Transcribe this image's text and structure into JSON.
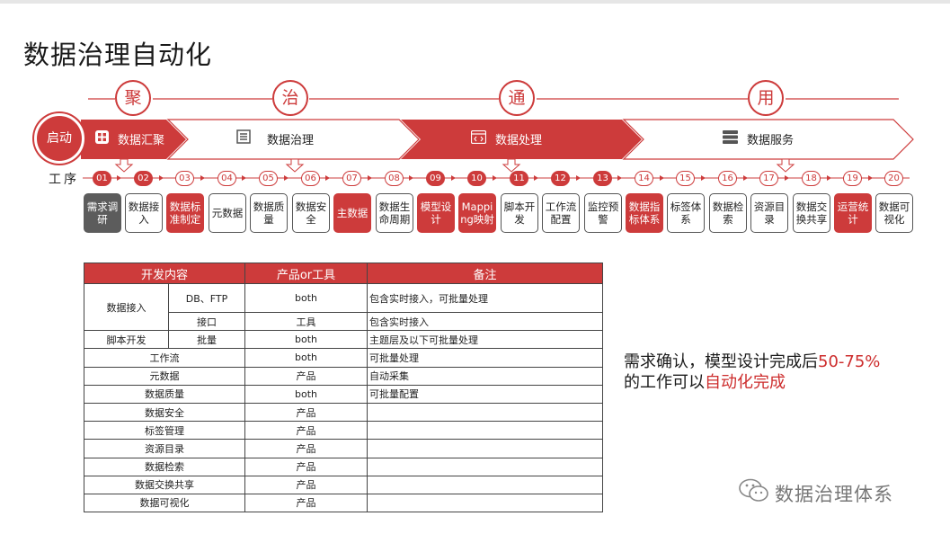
{
  "title": "数据治理自动化",
  "phase_chars": [
    "聚",
    "治",
    "通",
    "用"
  ],
  "start_label": "启动",
  "stages": [
    "数据汇聚",
    "数据治理",
    "数据处理",
    "数据服务"
  ],
  "gongxu_label": "工序",
  "steps": [
    {
      "num": "01",
      "label": "需求调研",
      "style": "gray"
    },
    {
      "num": "02",
      "label": "数据接入",
      "style": "outline"
    },
    {
      "num": "03",
      "label": "数据标准制定",
      "style": "red"
    },
    {
      "num": "04",
      "label": "元数据",
      "style": "outline"
    },
    {
      "num": "05",
      "label": "数据质量",
      "style": "outline"
    },
    {
      "num": "06",
      "label": "数据安全",
      "style": "outline"
    },
    {
      "num": "07",
      "label": "主数据",
      "style": "red"
    },
    {
      "num": "08",
      "label": "数据生命周期",
      "style": "outline"
    },
    {
      "num": "09",
      "label": "模型设计",
      "style": "red"
    },
    {
      "num": "10",
      "label": "Mapping映射",
      "style": "red"
    },
    {
      "num": "11",
      "label": "脚本开发",
      "style": "outline"
    },
    {
      "num": "12",
      "label": "工作流配置",
      "style": "outline"
    },
    {
      "num": "13",
      "label": "监控预警",
      "style": "outline"
    },
    {
      "num": "14",
      "label": "数据指标体系",
      "style": "red"
    },
    {
      "num": "15",
      "label": "标签体系",
      "style": "outline"
    },
    {
      "num": "16",
      "label": "数据检索",
      "style": "outline"
    },
    {
      "num": "17",
      "label": "资源目录",
      "style": "outline"
    },
    {
      "num": "18",
      "label": "数据交换共享",
      "style": "outline"
    },
    {
      "num": "19",
      "label": "运营统计",
      "style": "red"
    },
    {
      "num": "20",
      "label": "数据可视化",
      "style": "outline"
    }
  ],
  "table": {
    "headers": [
      "开发内容",
      "产品or工具",
      "备注"
    ],
    "r1": {
      "group": "数据接入",
      "sub": "DB、FTP",
      "tool": "both",
      "note": "包含实时接入，可批量处理"
    },
    "r2": {
      "sub": "接口",
      "tool": "工具",
      "note": "包含实时接入"
    },
    "r3": {
      "group": "脚本开发",
      "sub": "批量",
      "tool": "both",
      "note": "主题层及以下可批量处理"
    },
    "rows": [
      {
        "item": "工作流",
        "tool": "both",
        "note": "可批量处理"
      },
      {
        "item": "元数据",
        "tool": "产品",
        "note": "自动采集"
      },
      {
        "item": "数据质量",
        "tool": "both",
        "note": "可批量配置"
      },
      {
        "item": "数据安全",
        "tool": "产品",
        "note": ""
      },
      {
        "item": "标签管理",
        "tool": "产品",
        "note": ""
      },
      {
        "item": "资源目录",
        "tool": "产品",
        "note": ""
      },
      {
        "item": "数据检索",
        "tool": "产品",
        "note": ""
      },
      {
        "item": "数据交换共享",
        "tool": "产品",
        "note": ""
      },
      {
        "item": "数据可视化",
        "tool": "产品",
        "note": ""
      }
    ]
  },
  "note": {
    "line1_a": "需求确认，模型设计完成后",
    "line1_b": "50-75%",
    "line2_a": "的工作可以",
    "line2_b": "自动化完成"
  },
  "watermark": "数据治理体系",
  "colors": {
    "accent": "#cd3b3b",
    "dark_box": "#5c5c5c"
  }
}
